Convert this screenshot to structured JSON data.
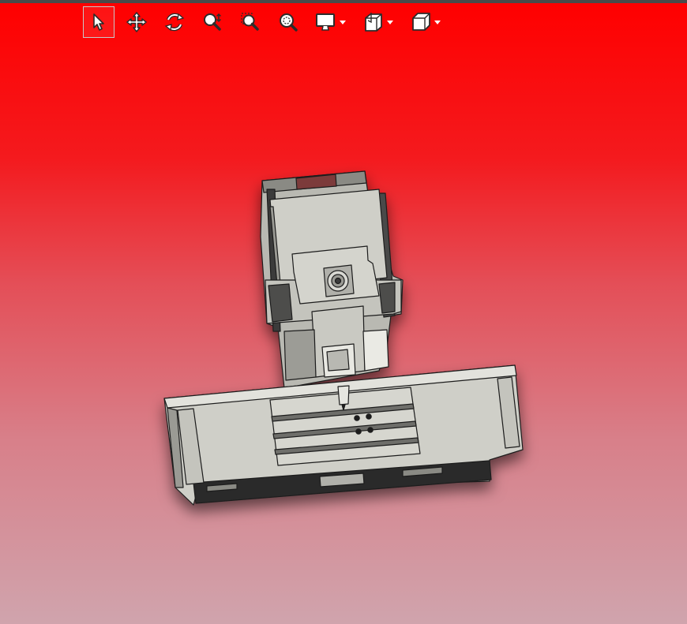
{
  "window": {
    "title": ""
  },
  "colors": {
    "viewport_top": "#ff0000",
    "viewport_bottom": "#d0a4ad",
    "icon_fill": "#ffffff",
    "icon_stroke": "#2b2b2b",
    "model_face": "#cfcfc8",
    "model_edge": "#1e1e1e"
  },
  "toolbar": {
    "items": [
      {
        "name": "select",
        "icon": "arrow-pointer-icon",
        "active": true
      },
      {
        "name": "pan",
        "icon": "move-arrows-icon",
        "active": false
      },
      {
        "name": "rotate",
        "icon": "rotate-icon",
        "active": false
      },
      {
        "name": "zoom",
        "icon": "zoom-icon",
        "active": false
      },
      {
        "name": "zoom-to-area",
        "icon": "zoom-area-icon",
        "active": false
      },
      {
        "name": "zoom-to-fit",
        "icon": "zoom-fit-icon",
        "active": false
      },
      {
        "name": "display-mode",
        "icon": "monitor-icon",
        "active": false,
        "dropdown": true
      },
      {
        "name": "section-view",
        "icon": "section-icon",
        "active": false,
        "dropdown": true
      },
      {
        "name": "view-orientation",
        "icon": "cube-icon",
        "active": false,
        "dropdown": true
      }
    ]
  },
  "viewport": {
    "content": "3d-model-machine-assembly"
  }
}
